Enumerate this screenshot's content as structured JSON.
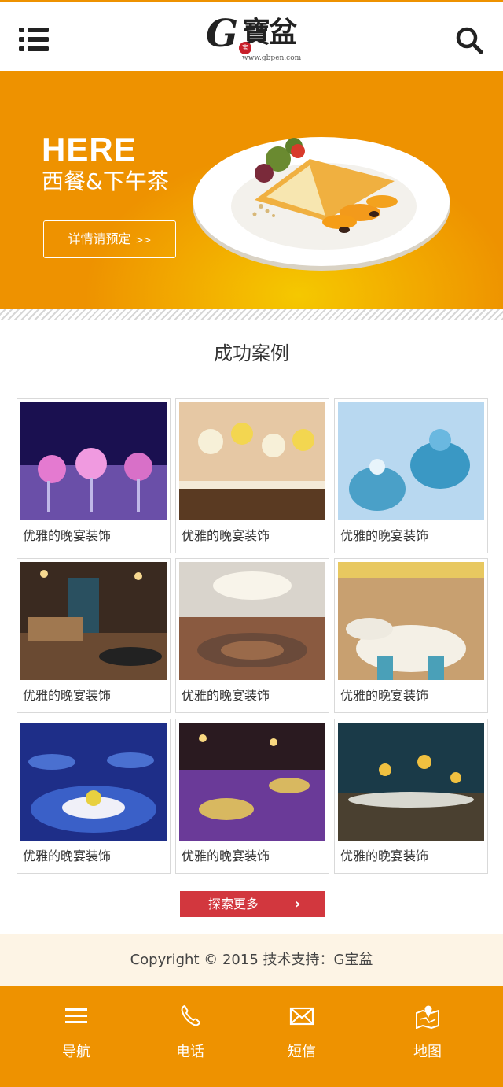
{
  "header": {
    "logo_letter": "G",
    "logo_chinese": "寶盆",
    "logo_seal": "宝",
    "logo_url": "www.gbpen.com"
  },
  "banner": {
    "title": "HERE",
    "subtitle": "西餐&下午茶",
    "button_label": "详情请预定",
    "button_arrow": ">>"
  },
  "cases": {
    "title": "成功案例",
    "items": [
      {
        "caption": "优雅的晚宴装饰"
      },
      {
        "caption": "优雅的晚宴装饰"
      },
      {
        "caption": "优雅的晚宴装饰"
      },
      {
        "caption": "优雅的晚宴装饰"
      },
      {
        "caption": "优雅的晚宴装饰"
      },
      {
        "caption": "优雅的晚宴装饰"
      },
      {
        "caption": "优雅的晚宴装饰"
      },
      {
        "caption": "优雅的晚宴装饰"
      },
      {
        "caption": "优雅的晚宴装饰"
      }
    ],
    "more_label": "探索更多",
    "more_arrow": "›"
  },
  "footer": {
    "copyright": "Copyright  © 2015 技术支持：G宝盆"
  },
  "tabbar": {
    "items": [
      {
        "label": "导航",
        "icon": "menu-lines-icon"
      },
      {
        "label": "电话",
        "icon": "phone-icon"
      },
      {
        "label": "短信",
        "icon": "envelope-icon"
      },
      {
        "label": "地图",
        "icon": "map-icon"
      }
    ]
  },
  "colors": {
    "accent": "#ee9200",
    "button_red": "#d2373e",
    "footer_bg": "#fdf4e5"
  }
}
